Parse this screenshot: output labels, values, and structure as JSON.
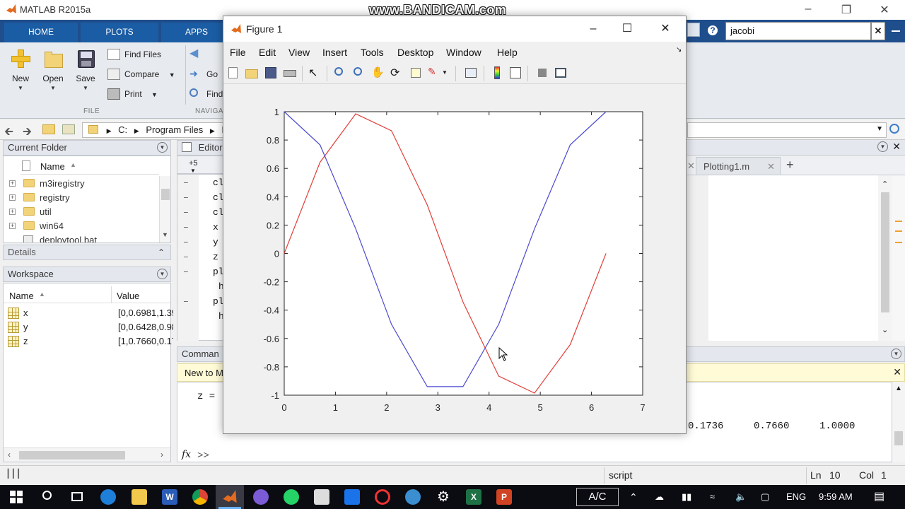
{
  "main_window": {
    "title": "MATLAB R2015a",
    "watermark": "www.BANDICAM.com",
    "search_value": "jacobi"
  },
  "ribbon": {
    "tabs": [
      "HOME",
      "PLOTS",
      "APPS"
    ],
    "new_label": "New",
    "open_label": "Open",
    "save_label": "Save",
    "find_files": "Find Files",
    "compare": "Compare",
    "print": "Print",
    "goto": "Go",
    "find": "Find",
    "group_file": "FILE",
    "group_navigate": "NAVIGA"
  },
  "address": {
    "drive": "C:",
    "folder": "Program Files",
    "next": "M"
  },
  "current_folder": {
    "title": "Current Folder",
    "column": "Name",
    "items": [
      {
        "name": "m3iregistry",
        "type": "folder"
      },
      {
        "name": "registry",
        "type": "folder"
      },
      {
        "name": "util",
        "type": "folder"
      },
      {
        "name": "win64",
        "type": "folder"
      },
      {
        "name": "deploytool.bat",
        "type": "file"
      }
    ]
  },
  "details": {
    "title": "Details"
  },
  "workspace": {
    "title": "Workspace",
    "col_name": "Name",
    "col_value": "Value",
    "vars": [
      {
        "name": "x",
        "value": "[0,0.6981,1.39"
      },
      {
        "name": "y",
        "value": "[0,0.6428,0.98"
      },
      {
        "name": "z",
        "value": "[1,0.7660,0.17"
      }
    ]
  },
  "editor": {
    "title": "Editor",
    "plus_count": "+5",
    "tab_name": "Plotting1.m",
    "code_lines": [
      "cl",
      "cl",
      "cl",
      "x",
      "y",
      "z",
      "pl",
      "h",
      "pl",
      "h"
    ]
  },
  "command_window": {
    "title": "Comman",
    "banner": "New to M",
    "line": "z =",
    "output": [
      "0.1736",
      "0.7660",
      "1.0000"
    ],
    "prompt": ">>"
  },
  "statusbar": {
    "mode": "script",
    "ln_label": "Ln",
    "ln_value": "10",
    "col_label": "Col",
    "col_value": "1"
  },
  "figure": {
    "title": "Figure 1",
    "menu": [
      "File",
      "Edit",
      "View",
      "Insert",
      "Tools",
      "Desktop",
      "Window",
      "Help"
    ]
  },
  "chart_data": {
    "type": "line",
    "title": "",
    "xlabel": "",
    "ylabel": "",
    "xlim": [
      0,
      7
    ],
    "ylim": [
      -1,
      1
    ],
    "xticks": [
      "0",
      "1",
      "2",
      "3",
      "4",
      "5",
      "6",
      "7"
    ],
    "yticks": [
      "-1",
      "-0.8",
      "-0.6",
      "-0.4",
      "-0.2",
      "0",
      "0.2",
      "0.4",
      "0.6",
      "0.8",
      "1"
    ],
    "grid": false,
    "x": [
      0,
      0.6981,
      1.3963,
      2.0944,
      2.7925,
      3.4907,
      4.1888,
      4.8869,
      5.5851,
      6.2832
    ],
    "series": [
      {
        "color": "#e0403a",
        "values": [
          0,
          0.6428,
          0.9848,
          0.866,
          0.342,
          -0.342,
          -0.866,
          -0.9848,
          -0.6428,
          0
        ]
      },
      {
        "color": "#4a4ad0",
        "values": [
          1,
          0.766,
          0.1736,
          -0.5,
          -0.9397,
          -0.9397,
          -0.5,
          0.1736,
          0.766,
          1
        ]
      }
    ]
  },
  "taskbar": {
    "ac_label": "A/C",
    "lang": "ENG",
    "time": "9:59 AM"
  }
}
